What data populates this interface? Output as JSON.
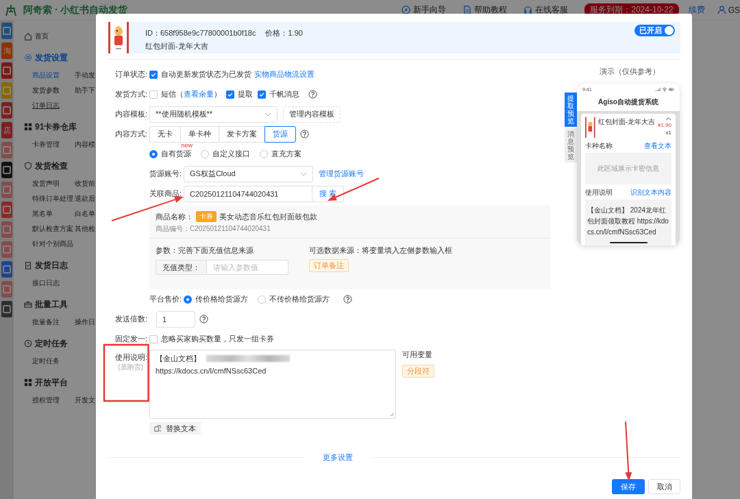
{
  "header": {
    "title": "阿奇索 · 小红书自动发货",
    "links": [
      {
        "kind": "guide",
        "label": "新手向导"
      },
      {
        "kind": "doc",
        "label": "帮助教程"
      },
      {
        "kind": "headset",
        "label": "在线客服"
      }
    ],
    "expiry": "服务到期：2024-10-22",
    "renew": "续费",
    "user": "GS"
  },
  "app_icons": [
    {
      "kind": "logo"
    },
    {
      "kind": "text",
      "text": "淘"
    },
    {
      "kind": "logo"
    },
    {
      "kind": "logo"
    },
    {
      "kind": "logo"
    },
    {
      "kind": "text",
      "text": "店"
    },
    {
      "kind": "logo"
    },
    {
      "kind": "logo"
    },
    {
      "kind": "logo"
    },
    {
      "kind": "logo"
    },
    {
      "kind": "logo"
    },
    {
      "kind": "logo"
    },
    {
      "kind": "logo"
    },
    {
      "kind": "logo"
    },
    {
      "kind": "logo"
    }
  ],
  "sidebar": {
    "home": "首页",
    "sections": [
      {
        "title": "发货设置",
        "selected": true,
        "items": [
          {
            "label": "商品设置",
            "selected": true,
            "hovered": false
          },
          {
            "label": "手动发",
            "selected": false,
            "hovered": false
          },
          {
            "label": "发货参数",
            "selected": false,
            "hovered": false
          },
          {
            "label": "助手下",
            "selected": false,
            "hovered": false
          },
          {
            "label": "订单日志",
            "selected": false,
            "hovered": true
          }
        ]
      },
      {
        "title": "91卡券仓库",
        "selected": false,
        "items": [
          {
            "label": "卡券管理",
            "selected": false,
            "hovered": false
          },
          {
            "label": "内容模",
            "selected": false,
            "hovered": false
          }
        ]
      },
      {
        "title": "发货检查",
        "selected": false,
        "items": [
          {
            "label": "发货声明",
            "selected": false,
            "hovered": false
          },
          {
            "label": "收货前",
            "selected": false,
            "hovered": false
          },
          {
            "label": "特殊订单处理",
            "selected": false,
            "hovered": false
          },
          {
            "label": "退款后",
            "selected": false,
            "hovered": false
          },
          {
            "label": "黑名单",
            "selected": false,
            "hovered": false
          },
          {
            "label": "白名单",
            "selected": false,
            "hovered": false
          },
          {
            "label": "默认检查方案",
            "selected": false,
            "hovered": false
          },
          {
            "label": "其他检",
            "selected": false,
            "hovered": false
          },
          {
            "label": "针对个别商品",
            "selected": false,
            "hovered": false
          }
        ]
      },
      {
        "title": "发货日志",
        "selected": false,
        "items": [
          {
            "label": "接口日志",
            "selected": false,
            "hovered": false
          }
        ]
      },
      {
        "title": "批量工具",
        "selected": false,
        "items": [
          {
            "label": "批量备注",
            "selected": false,
            "hovered": false
          },
          {
            "label": "操作日",
            "selected": false,
            "hovered": false
          }
        ]
      },
      {
        "title": "定时任务",
        "selected": false,
        "items": [
          {
            "label": "定时任务",
            "selected": false,
            "hovered": false
          }
        ]
      },
      {
        "title": "开放平台",
        "selected": false,
        "items": [
          {
            "label": "授权管理",
            "selected": false,
            "hovered": false
          },
          {
            "label": "开发文",
            "selected": false,
            "hovered": false
          }
        ]
      }
    ]
  },
  "product": {
    "id": "ID：658f958e9c77800001b0f18c",
    "price": "价格：1.90",
    "name": "红包封面-龙年大吉",
    "toggle": {
      "label": "已开启",
      "on": true
    }
  },
  "order_status": {
    "label": "订单状态:",
    "option": {
      "label": "自动更新发货状态为已发货",
      "checked": true
    },
    "link": "实物商品物流设置"
  },
  "delivery_method": {
    "label": "发货方式:",
    "options": [
      {
        "label": "短信（",
        "link": "查看余量",
        "suffix": "）",
        "checked": false
      },
      {
        "label": "提取",
        "checked": true
      },
      {
        "label": "千帆消息",
        "checked": true
      }
    ]
  },
  "content_template": {
    "label": "内容模板:",
    "value": "**使用随机模板**",
    "button": "管理内容模板"
  },
  "content_mode": {
    "label": "内容方式:",
    "options": [
      {
        "label": "无卡",
        "selected": false
      },
      {
        "label": "单卡种",
        "selected": false
      },
      {
        "label": "发卡方案",
        "selected": false
      },
      {
        "label": "货源",
        "selected": true
      }
    ]
  },
  "source_type": [
    {
      "label": "自有货源",
      "selected": true,
      "badge": "new"
    },
    {
      "label": "自定义接口",
      "selected": false
    },
    {
      "label": "直充方案",
      "selected": false
    }
  ],
  "source_account": {
    "label": "货源账号:",
    "value": "GS权益Cloud",
    "link": "管理货源账号"
  },
  "linked_product": {
    "label": "关联商品:",
    "value": "C20250121104744020431",
    "button": "搜 索"
  },
  "product_panel": {
    "name_label": "商品名称：",
    "tag": "卡券",
    "name": "美女动态音乐红包封面鼓包款",
    "code": "商品编号：C20250121104744020431",
    "params_label": "参数：完善下面充值信息来源",
    "param": {
      "label": "充值类型：",
      "placeholder": "请输入参数值"
    },
    "sources_label": "可选数据来源：将变量填入左侧参数输入框",
    "source_tag": "订单备注"
  },
  "platform_price": {
    "label": "平台售价:",
    "options": [
      {
        "label": "传价格给货源方",
        "selected": true
      },
      {
        "label": "不传价格给货源方",
        "selected": false
      }
    ]
  },
  "send_multiple": {
    "label": "发送倍数:",
    "value": "1"
  },
  "fixed_one": {
    "label": "固定发一:",
    "option": {
      "label": "忽略买家购买数量，只发一组卡券",
      "checked": false
    }
  },
  "instructions": {
    "label": "使用说明:",
    "sublabel": "(原附言)",
    "lines": [
      "【金山文档】",
      "https://kdocs.cn/l/cmfNSsc63Ced"
    ],
    "redacted": true,
    "vars_label": "可用变量",
    "var_tag": "分段符",
    "replace_button": "替换文本"
  },
  "more_settings": "更多设置",
  "footer": {
    "save": "保存",
    "cancel": "取消"
  },
  "preview": {
    "title": "演示（仅供参考）",
    "tabs": [
      {
        "label": "提取预览",
        "selected": true
      },
      {
        "label": "消息预览",
        "selected": false
      }
    ],
    "phone": {
      "time": "9:41",
      "app_title": "Agiso自动提货系统",
      "product_name": "红包封面-龙年大吉",
      "price": "¥1.90",
      "qty": "x1",
      "card_label": "卡种名称",
      "card_link": "查看文本",
      "card_placeholder": "此区域展示卡密信息",
      "usage_label": "使用说明",
      "usage_link": "识别文本内容",
      "usage_text": "【金山文档】 2024龙年红包封面领取教程 https://kdocs.cn/l/cmfNSsc63Ced"
    }
  }
}
